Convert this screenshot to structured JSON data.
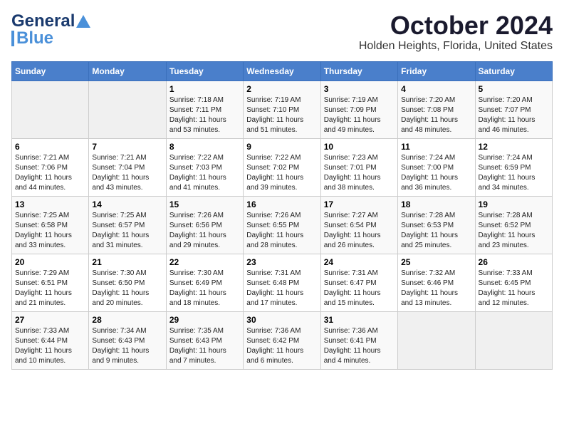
{
  "header": {
    "logo_line1": "General",
    "logo_line2": "Blue",
    "title": "October 2024",
    "subtitle": "Holden Heights, Florida, United States"
  },
  "calendar": {
    "weekdays": [
      "Sunday",
      "Monday",
      "Tuesday",
      "Wednesday",
      "Thursday",
      "Friday",
      "Saturday"
    ],
    "weeks": [
      [
        {
          "day": "",
          "info": ""
        },
        {
          "day": "",
          "info": ""
        },
        {
          "day": "1",
          "info": "Sunrise: 7:18 AM\nSunset: 7:11 PM\nDaylight: 11 hours\nand 53 minutes."
        },
        {
          "day": "2",
          "info": "Sunrise: 7:19 AM\nSunset: 7:10 PM\nDaylight: 11 hours\nand 51 minutes."
        },
        {
          "day": "3",
          "info": "Sunrise: 7:19 AM\nSunset: 7:09 PM\nDaylight: 11 hours\nand 49 minutes."
        },
        {
          "day": "4",
          "info": "Sunrise: 7:20 AM\nSunset: 7:08 PM\nDaylight: 11 hours\nand 48 minutes."
        },
        {
          "day": "5",
          "info": "Sunrise: 7:20 AM\nSunset: 7:07 PM\nDaylight: 11 hours\nand 46 minutes."
        }
      ],
      [
        {
          "day": "6",
          "info": "Sunrise: 7:21 AM\nSunset: 7:06 PM\nDaylight: 11 hours\nand 44 minutes."
        },
        {
          "day": "7",
          "info": "Sunrise: 7:21 AM\nSunset: 7:04 PM\nDaylight: 11 hours\nand 43 minutes."
        },
        {
          "day": "8",
          "info": "Sunrise: 7:22 AM\nSunset: 7:03 PM\nDaylight: 11 hours\nand 41 minutes."
        },
        {
          "day": "9",
          "info": "Sunrise: 7:22 AM\nSunset: 7:02 PM\nDaylight: 11 hours\nand 39 minutes."
        },
        {
          "day": "10",
          "info": "Sunrise: 7:23 AM\nSunset: 7:01 PM\nDaylight: 11 hours\nand 38 minutes."
        },
        {
          "day": "11",
          "info": "Sunrise: 7:24 AM\nSunset: 7:00 PM\nDaylight: 11 hours\nand 36 minutes."
        },
        {
          "day": "12",
          "info": "Sunrise: 7:24 AM\nSunset: 6:59 PM\nDaylight: 11 hours\nand 34 minutes."
        }
      ],
      [
        {
          "day": "13",
          "info": "Sunrise: 7:25 AM\nSunset: 6:58 PM\nDaylight: 11 hours\nand 33 minutes."
        },
        {
          "day": "14",
          "info": "Sunrise: 7:25 AM\nSunset: 6:57 PM\nDaylight: 11 hours\nand 31 minutes."
        },
        {
          "day": "15",
          "info": "Sunrise: 7:26 AM\nSunset: 6:56 PM\nDaylight: 11 hours\nand 29 minutes."
        },
        {
          "day": "16",
          "info": "Sunrise: 7:26 AM\nSunset: 6:55 PM\nDaylight: 11 hours\nand 28 minutes."
        },
        {
          "day": "17",
          "info": "Sunrise: 7:27 AM\nSunset: 6:54 PM\nDaylight: 11 hours\nand 26 minutes."
        },
        {
          "day": "18",
          "info": "Sunrise: 7:28 AM\nSunset: 6:53 PM\nDaylight: 11 hours\nand 25 minutes."
        },
        {
          "day": "19",
          "info": "Sunrise: 7:28 AM\nSunset: 6:52 PM\nDaylight: 11 hours\nand 23 minutes."
        }
      ],
      [
        {
          "day": "20",
          "info": "Sunrise: 7:29 AM\nSunset: 6:51 PM\nDaylight: 11 hours\nand 21 minutes."
        },
        {
          "day": "21",
          "info": "Sunrise: 7:30 AM\nSunset: 6:50 PM\nDaylight: 11 hours\nand 20 minutes."
        },
        {
          "day": "22",
          "info": "Sunrise: 7:30 AM\nSunset: 6:49 PM\nDaylight: 11 hours\nand 18 minutes."
        },
        {
          "day": "23",
          "info": "Sunrise: 7:31 AM\nSunset: 6:48 PM\nDaylight: 11 hours\nand 17 minutes."
        },
        {
          "day": "24",
          "info": "Sunrise: 7:31 AM\nSunset: 6:47 PM\nDaylight: 11 hours\nand 15 minutes."
        },
        {
          "day": "25",
          "info": "Sunrise: 7:32 AM\nSunset: 6:46 PM\nDaylight: 11 hours\nand 13 minutes."
        },
        {
          "day": "26",
          "info": "Sunrise: 7:33 AM\nSunset: 6:45 PM\nDaylight: 11 hours\nand 12 minutes."
        }
      ],
      [
        {
          "day": "27",
          "info": "Sunrise: 7:33 AM\nSunset: 6:44 PM\nDaylight: 11 hours\nand 10 minutes."
        },
        {
          "day": "28",
          "info": "Sunrise: 7:34 AM\nSunset: 6:43 PM\nDaylight: 11 hours\nand 9 minutes."
        },
        {
          "day": "29",
          "info": "Sunrise: 7:35 AM\nSunset: 6:43 PM\nDaylight: 11 hours\nand 7 minutes."
        },
        {
          "day": "30",
          "info": "Sunrise: 7:36 AM\nSunset: 6:42 PM\nDaylight: 11 hours\nand 6 minutes."
        },
        {
          "day": "31",
          "info": "Sunrise: 7:36 AM\nSunset: 6:41 PM\nDaylight: 11 hours\nand 4 minutes."
        },
        {
          "day": "",
          "info": ""
        },
        {
          "day": "",
          "info": ""
        }
      ]
    ]
  }
}
